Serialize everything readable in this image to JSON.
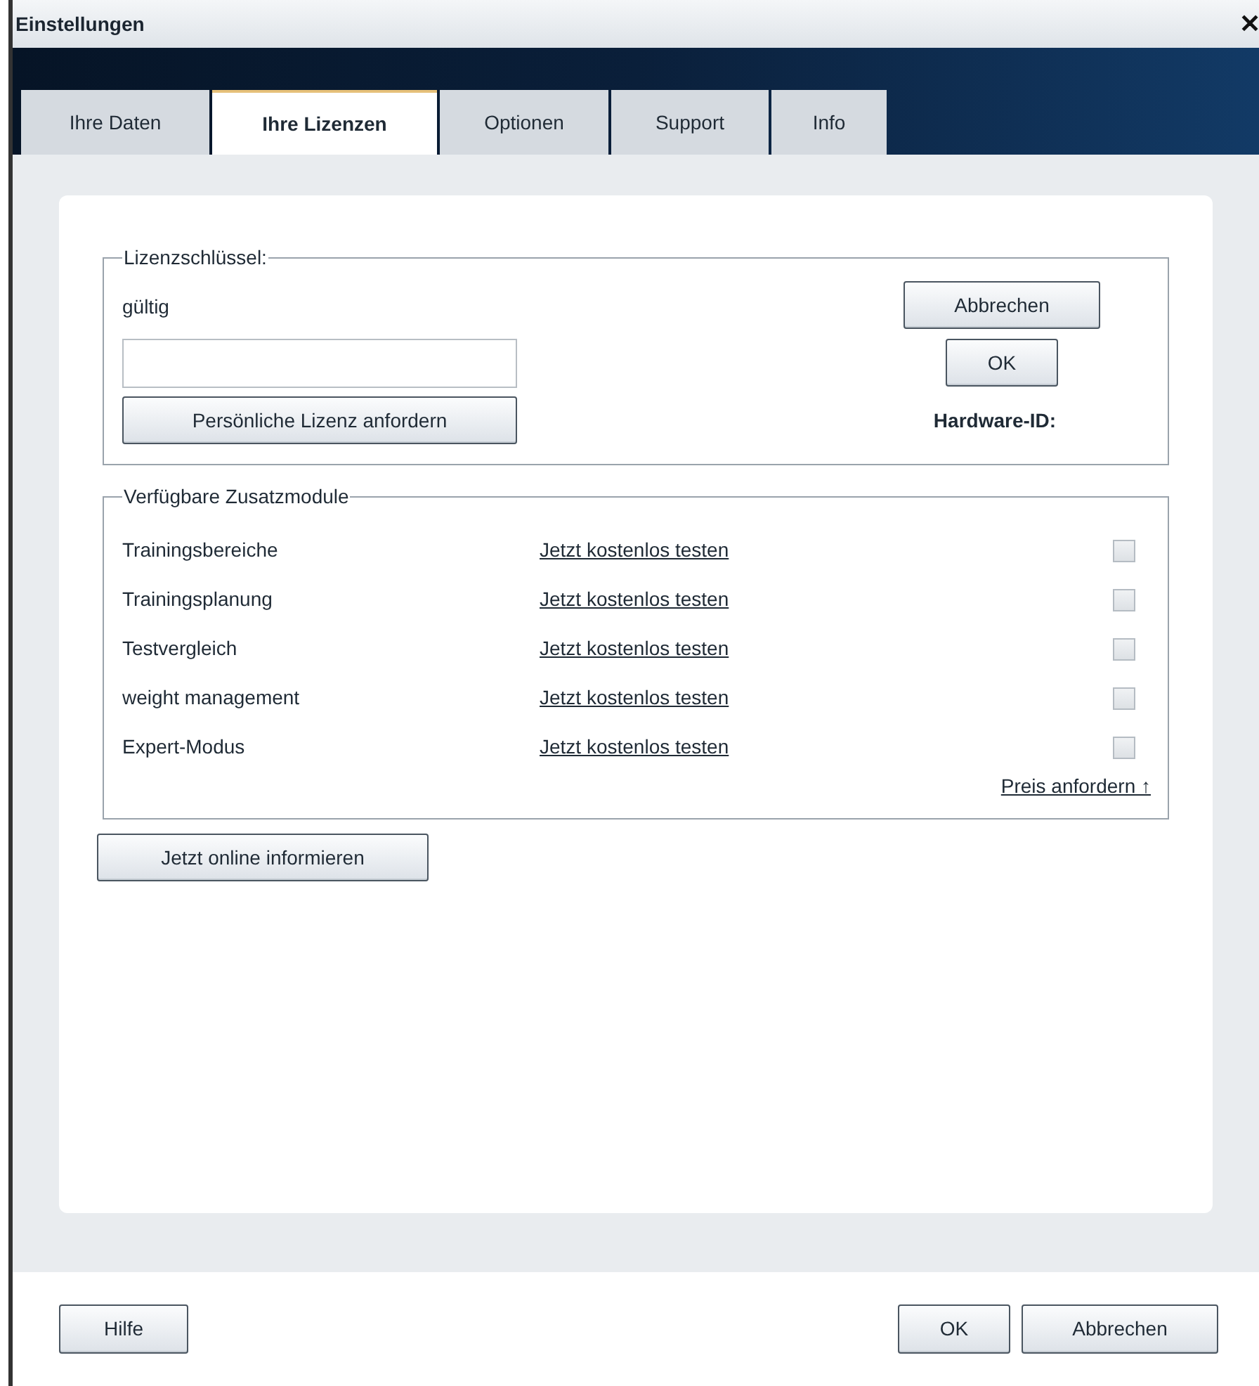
{
  "window": {
    "title": "Einstellungen",
    "close": "✕"
  },
  "tabs": [
    {
      "label": "Ihre Daten",
      "selected": false
    },
    {
      "label": "Ihre Lizenzen",
      "selected": true
    },
    {
      "label": "Optionen",
      "selected": false
    },
    {
      "label": "Support",
      "selected": false
    },
    {
      "label": "Info",
      "selected": false
    }
  ],
  "license": {
    "legend": "Lizenzschlüssel:",
    "status": "gültig",
    "request_button": "Persönliche Lizenz anfordern",
    "cancel_button": "Abbrechen",
    "ok_button": "OK",
    "hardware_id_label": "Hardware-ID:"
  },
  "modules": {
    "legend": "Verfügbare Zusatzmodule",
    "items": [
      {
        "name": "Trainingsbereiche",
        "link": "Jetzt kostenlos testen",
        "checked": false
      },
      {
        "name": "Trainingsplanung",
        "link": "Jetzt kostenlos testen",
        "checked": false
      },
      {
        "name": "Testvergleich",
        "link": "Jetzt kostenlos testen",
        "checked": false
      },
      {
        "name": "weight management",
        "link": "Jetzt kostenlos testen",
        "checked": false
      },
      {
        "name": "Expert-Modus",
        "link": "Jetzt kostenlos testen",
        "checked": false
      }
    ],
    "price_link": "Preis anfordern ↑"
  },
  "info_button": "Jetzt online informieren",
  "footer": {
    "help_button": "Hilfe",
    "ok_button": "OK",
    "cancel_button": "Abbrechen"
  }
}
